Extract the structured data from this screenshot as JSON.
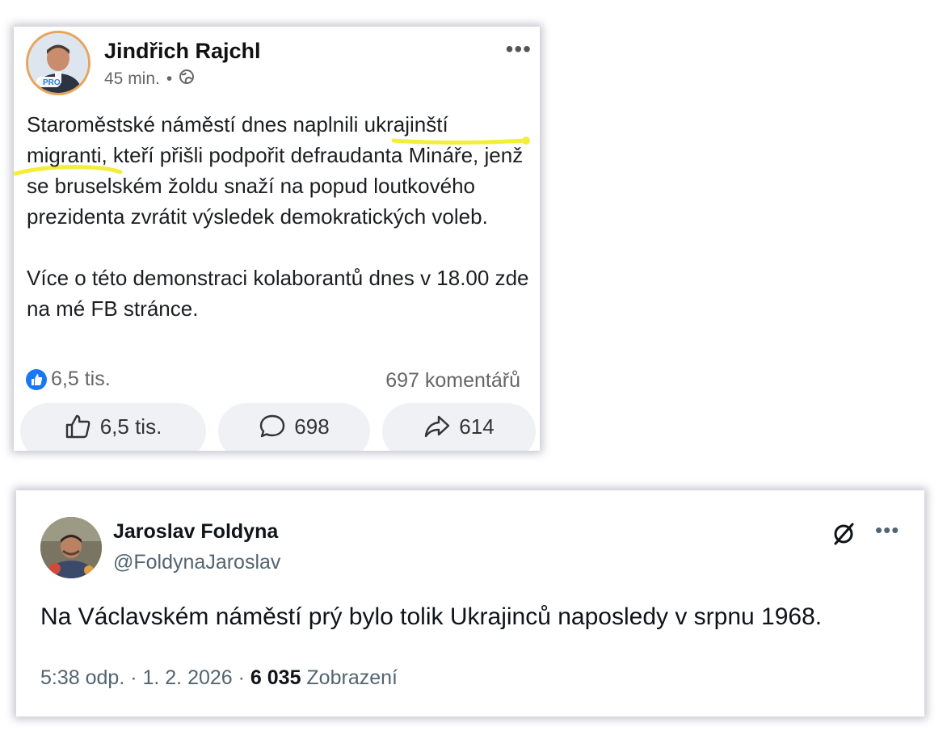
{
  "facebook_post": {
    "author": "Jindřich Rajchl",
    "avatar_badge": "PRO",
    "time": "45 min.",
    "separator": "•",
    "privacy_icon": "globe-icon",
    "paragraph1_a": "Staroměstské náměstí dnes naplnili ",
    "paragraph1_hl1": "ukrajinští",
    "paragraph1_hl2": "migranti,",
    "paragraph1_b": " kteří přišli podpořit defraudanta Mináře, jenž se bruselském žoldu snaží na popud loutkového prezidenta zvrátit výsledek demokratických voleb.",
    "paragraph2": "Více o této demonstraci kolaborantů dnes v 18.00 zde na mé FB stránce.",
    "reactions_count": "6,5 tis.",
    "comments_summary": "697 komentářů",
    "like_button": "6,5 tis.",
    "comment_button": "698",
    "share_button": "614",
    "highlight_color": "#f2ee3a"
  },
  "x_post": {
    "author": "Jaroslav Foldyna",
    "handle": "@FoldynaJaroslav",
    "text": "Na Václavském náměstí prý bylo tolik Ukrajinců naposledy v srpnu 1968.",
    "timestamp": "5:38 odp. · 1. 2. 2026 · ",
    "views_count": "6 035",
    "views_label": " Zobrazení"
  }
}
